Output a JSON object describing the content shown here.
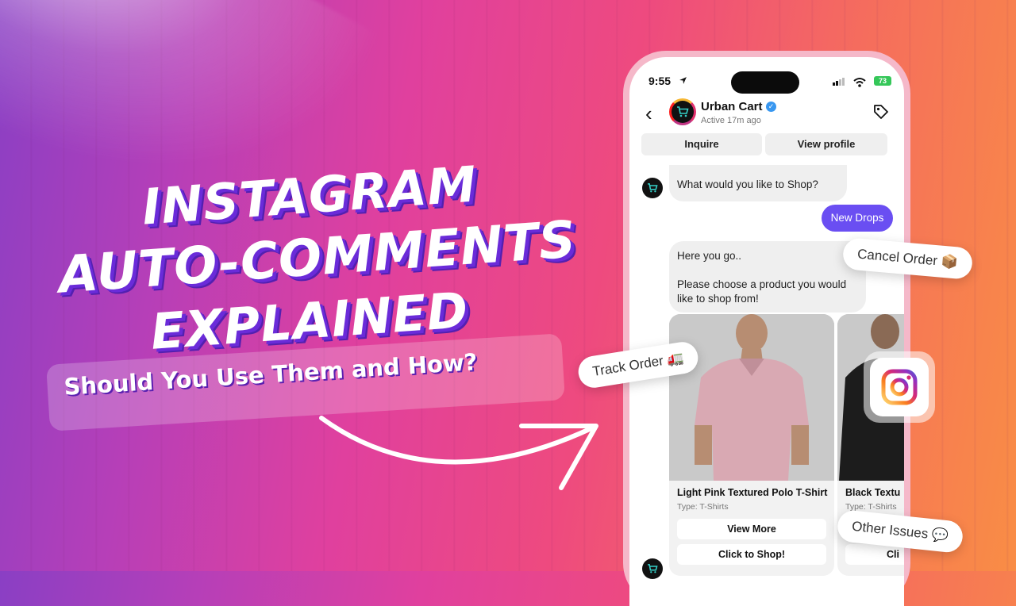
{
  "hero": {
    "line1": "INSTAGRAM",
    "line2": "AUTO-COMMENTS",
    "line3": "EXPLAINED",
    "subtitle": "Should You Use Them and How?"
  },
  "phone": {
    "status": {
      "time": "9:55",
      "battery": "73"
    },
    "chat": {
      "name": "Urban Cart",
      "active": "Active 17m ago",
      "tabs": [
        "Inquire",
        "View profile"
      ]
    },
    "messages": {
      "first": "What would you like to Shop?",
      "reply": "New Drops",
      "second_line1": "Here you go..",
      "second_line2": "Please choose a product you would like to shop from!"
    },
    "products": [
      {
        "title": "Light Pink Textured Polo T-Shirt",
        "type": "Type: T-Shirts",
        "btn1": "View More",
        "btn2": "Click to Shop!"
      },
      {
        "title": "Black Textu",
        "type": "Type: T-Shirts",
        "btn2": "Cli"
      }
    ]
  },
  "chips": {
    "cancel": "Cancel Order 📦",
    "track": "Track Order 🚛",
    "other": "Other Issues 💬"
  },
  "colors": {
    "accent": "#6a4ef2",
    "headline_shadow": "#6a2bd9",
    "bg_left": "#8a3fc4",
    "bg_right": "#f98d45"
  },
  "icons": [
    "back-chevron-icon",
    "verified-badge-icon",
    "tag-icon",
    "cart-icon",
    "instagram-icon",
    "location-arrow-icon",
    "wifi-icon",
    "signal-icon"
  ]
}
